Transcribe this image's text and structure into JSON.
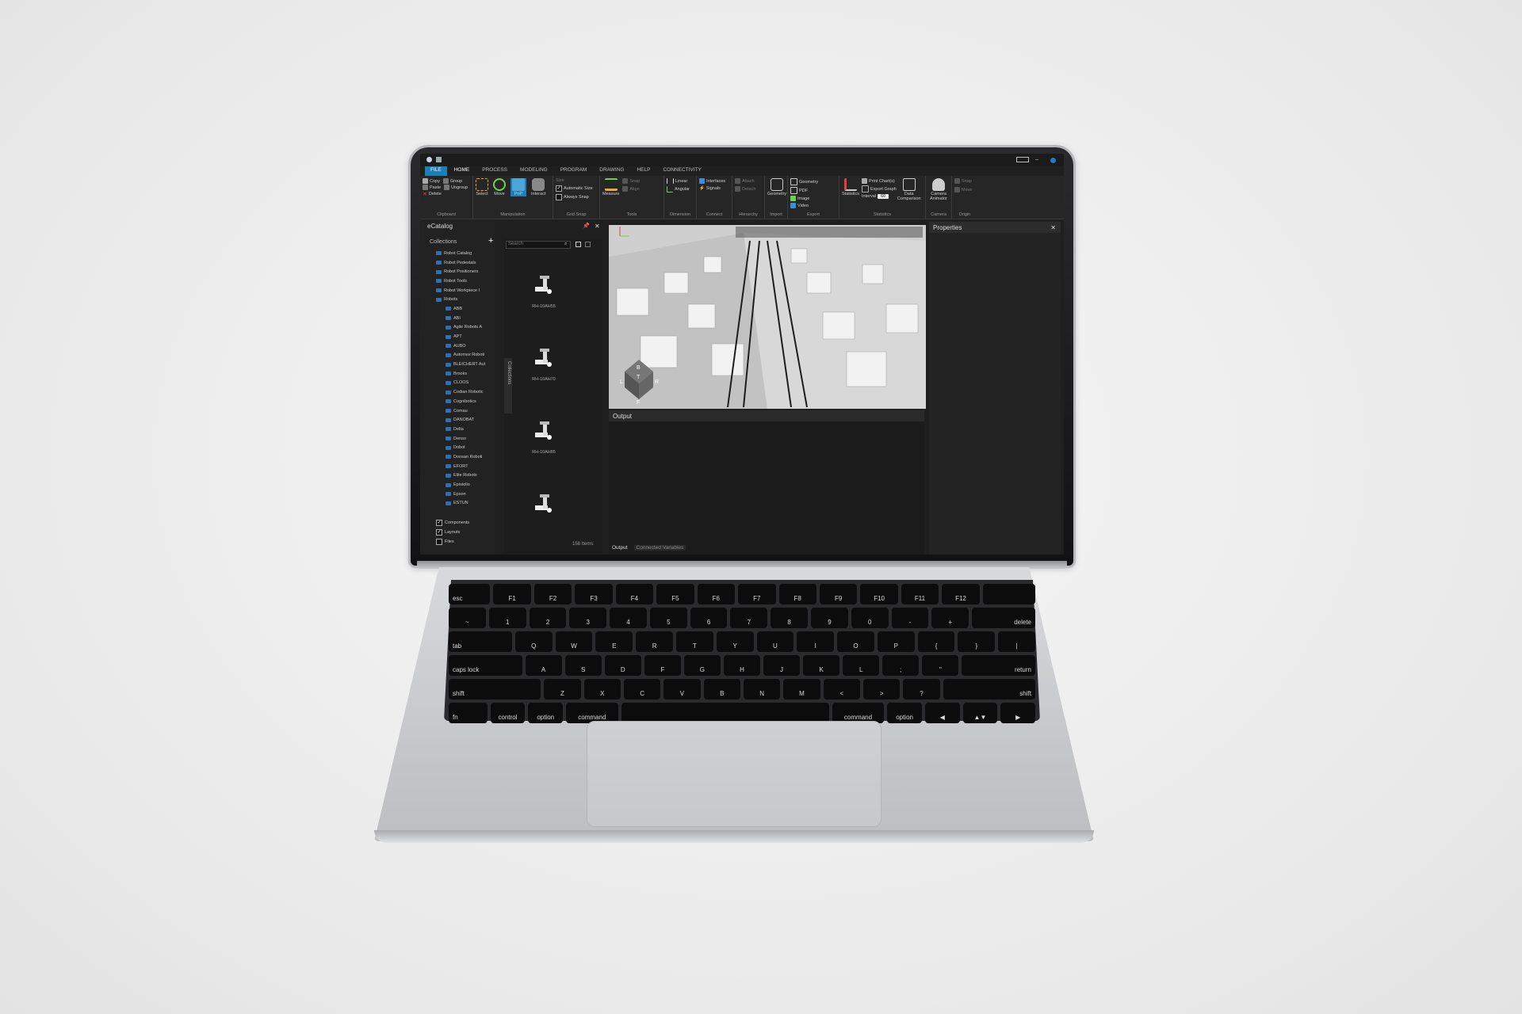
{
  "app": {
    "tabs": [
      "FILE",
      "HOME",
      "PROCESS",
      "MODELING",
      "PROGRAM",
      "DRAWING",
      "HELP",
      "CONNECTIVITY"
    ],
    "active_tab": "HOME"
  },
  "ribbon": {
    "clipboard": {
      "label": "Clipboard",
      "copy": "Copy",
      "paste": "Paste",
      "delete": "Delete",
      "group": "Group",
      "ungroup": "Ungroup"
    },
    "manipulation": {
      "label": "Manipulation",
      "select": "Select",
      "move": "Move",
      "pnp": "PnP",
      "interact": "Interact"
    },
    "grid_snap": {
      "label": "Grid Snap",
      "automatic_size": "Automatic Size",
      "always_snap": "Always Snap",
      "size": "Size"
    },
    "tools": {
      "label": "Tools",
      "measure": "Measure",
      "snap": "Snap",
      "align": "Align"
    },
    "dimension": {
      "label": "Dimension",
      "linear": "Linear",
      "angular": "Angular"
    },
    "connect": {
      "label": "Connect",
      "interfaces": "Interfaces",
      "signals": "Signals"
    },
    "hierarchy": {
      "label": "Hierarchy",
      "attach": "Attach",
      "detach": "Detach"
    },
    "import": {
      "label": "Import",
      "geometry": "Geometry"
    },
    "export": {
      "label": "Export",
      "geometry": "Geometry",
      "pdf": "PDF",
      "image": "Image",
      "video": "Video"
    },
    "statistics": {
      "label": "Statistics",
      "statistics": "Statistics",
      "print_charts": "Print Chart(s)",
      "export_graph": "Export Graph",
      "interval": "Interval",
      "interval_value": "60",
      "data_comparison": "Data Comparison"
    },
    "camera": {
      "label": "Camera",
      "camera_animator": "Camera Animator"
    },
    "origin": {
      "label": "Origin",
      "snap": "Snap",
      "move": "Move"
    }
  },
  "ecatalog": {
    "title": "eCatalog",
    "collections": "Collections",
    "tree": [
      "Robot Catalog",
      "Robot Pedestals",
      "Robot Positioners",
      "Robot Tools",
      "Robot Workpiece I",
      "Robots",
      "ABB",
      "ABI",
      "Agile Robots A",
      "APT",
      "AUBO",
      "Automox Roboti",
      "BLEICHERT Aut",
      "Brooks",
      "CLOOS",
      "Codian Robotic",
      "Cognibotics",
      "Comau",
      "DANOBAT",
      "Delta",
      "Denso",
      "Dobot",
      "Doosan Roboti",
      "EFORT",
      "Elite Robots",
      "Epistolio",
      "Epson",
      "ESTUN"
    ],
    "filters": [
      {
        "label": "Components",
        "checked": true
      },
      {
        "label": "Layouts",
        "checked": true
      },
      {
        "label": "Files",
        "checked": false
      }
    ],
    "search_placeholder": "Search",
    "side_tab": "Collections",
    "items": [
      "RH-10AH55",
      "RH-10AH70",
      "RH-10AH85"
    ],
    "item_count": "158 Items"
  },
  "viewport": {
    "cube": [
      "B",
      "L",
      "T",
      "R",
      "F"
    ]
  },
  "output": {
    "title": "Output",
    "tabs": [
      "Output",
      "Connected Variables"
    ]
  },
  "properties": {
    "title": "Properties"
  },
  "keyboard": {
    "rows": [
      [
        "esc",
        "F1",
        "F2",
        "F3",
        "F4",
        "F5",
        "F6",
        "F7",
        "F8",
        "F9",
        "F10",
        "F11",
        "F12",
        ""
      ],
      [
        "~",
        "1",
        "2",
        "3",
        "4",
        "5",
        "6",
        "7",
        "8",
        "9",
        "0",
        "-",
        "+",
        "delete"
      ],
      [
        "tab",
        "Q",
        "W",
        "E",
        "R",
        "T",
        "Y",
        "U",
        "I",
        "O",
        "P",
        "{",
        "}",
        "|"
      ],
      [
        "caps lock",
        "A",
        "S",
        "D",
        "F",
        "G",
        "H",
        "J",
        "K",
        "L",
        ";",
        "\"",
        "return"
      ],
      [
        "shift",
        "Z",
        "X",
        "C",
        "V",
        "B",
        "N",
        "M",
        "<",
        ">",
        "?",
        "shift"
      ],
      [
        "fn",
        "control",
        "option",
        "command",
        "",
        "command",
        "option",
        "◀",
        "▲▼",
        "▶"
      ]
    ]
  },
  "colors": {
    "accent": "#1e7fb8",
    "folder": "#2f6fb3",
    "screen_bg": "#1f1f1f"
  }
}
